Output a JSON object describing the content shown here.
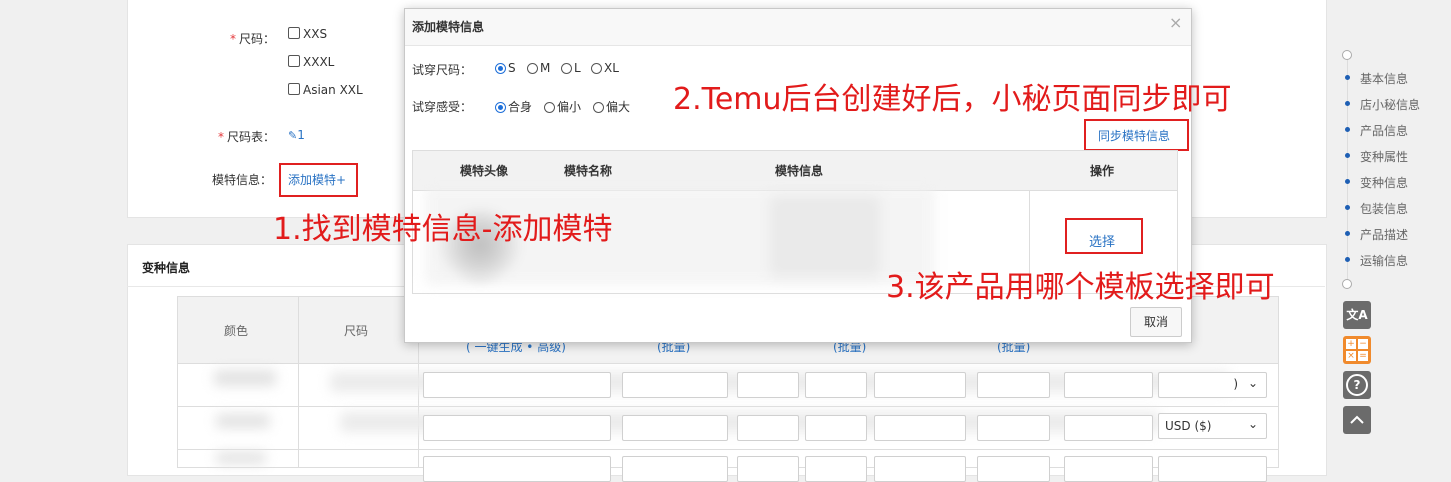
{
  "form": {
    "size_label": "尺码",
    "size_options": [
      "XXS",
      "XXXL",
      "Asian XXL"
    ],
    "size_chart_label": "尺码表",
    "size_chart_value": "1",
    "model_label": "模特信息",
    "add_model_link": "添加模特+"
  },
  "variant_section": {
    "title": "变种信息",
    "headers": [
      "颜色",
      "尺码"
    ],
    "batch_links": [
      "( 一键生成 • 高级)",
      "(批量)",
      "(批量)",
      "(批量)"
    ],
    "currency_value": "USD ($)",
    "currency_value_short": ")"
  },
  "dialog": {
    "title": "添加模特信息",
    "close": "×",
    "trial_size_label": "试穿尺码",
    "trial_size_options": [
      "S",
      "M",
      "L",
      "XL"
    ],
    "trial_size_selected": "S",
    "trial_feel_label": "试穿感受",
    "trial_feel_options": [
      "合身",
      "偏小",
      "偏大"
    ],
    "trial_feel_selected": "合身",
    "sync_button": "同步模特信息",
    "table_headers": [
      "模特头像",
      "模特名称",
      "模特信息",
      "操作"
    ],
    "select_link": "选择",
    "cancel_button": "取消"
  },
  "annotations": {
    "step1": "1.找到模特信息-添加模特",
    "step2": "2.Temu后台创建好后，小秘页面同步即可",
    "step3": "3.该产品用哪个模板选择即可"
  },
  "side_nav": {
    "items": [
      "基本信息",
      "店小秘信息",
      "产品信息",
      "变种属性",
      "变种信息",
      "包装信息",
      "产品描述",
      "运输信息"
    ]
  },
  "tools": {
    "translate_icon": "文A",
    "calculator_icon": "calculator",
    "help_icon": "?",
    "top_icon": "chevron-up"
  },
  "colors": {
    "annotation_red": "#e21b1b",
    "link_blue": "#2a73c4",
    "nav_dot": "#1e5fb4"
  }
}
